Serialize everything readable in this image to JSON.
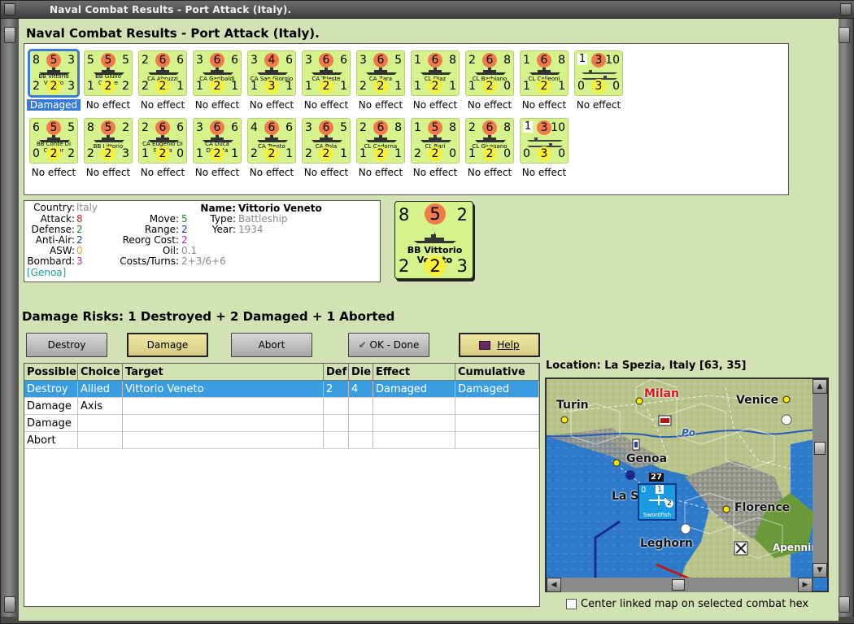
{
  "window": {
    "title": "Naval Combat Results - Port Attack (Italy)."
  },
  "dialog": {
    "title": "Naval Combat Results - Port Attack (Italy)."
  },
  "units_row1": [
    {
      "tl": "8",
      "c": "5",
      "tr": "3",
      "name": "BB Vittorio Veneto",
      "bl": "2",
      "y": "2",
      "br": "3",
      "result": "Damaged",
      "selected": true
    },
    {
      "tl": "5",
      "c": "5",
      "tr": "5",
      "name": "BB Giulio Cesare",
      "bl": "1",
      "y": "2",
      "br": "2",
      "result": "No effect"
    },
    {
      "tl": "2",
      "c": "6",
      "tr": "6",
      "name": "CA Abruzzi",
      "bl": "2",
      "y": "2",
      "br": "1",
      "result": "No effect"
    },
    {
      "tl": "3",
      "c": "6",
      "tr": "6",
      "name": "CA Garibaldi",
      "bl": "1",
      "y": "2",
      "br": "1",
      "result": "No effect"
    },
    {
      "tl": "3",
      "c": "4",
      "tr": "6",
      "name": "CA San Giorgio",
      "bl": "1",
      "y": "3",
      "br": "1",
      "result": "No effect"
    },
    {
      "tl": "3",
      "c": "6",
      "tr": "6",
      "name": "CA Trieste",
      "bl": "1",
      "y": "2",
      "br": "1",
      "result": "No effect"
    },
    {
      "tl": "3",
      "c": "6",
      "tr": "5",
      "name": "CA Zara",
      "bl": "2",
      "y": "2",
      "br": "1",
      "result": "No effect"
    },
    {
      "tl": "1",
      "c": "6",
      "tr": "8",
      "name": "CL Diaz",
      "bl": "1",
      "y": "2",
      "br": "1",
      "result": "No effect"
    },
    {
      "tl": "2",
      "c": "6",
      "tr": "8",
      "name": "CL Barbiano",
      "bl": "1",
      "y": "2",
      "br": "0",
      "result": "No effect"
    },
    {
      "tl": "1",
      "c": "6",
      "tr": "8",
      "name": "CL Colleoni",
      "bl": "1",
      "y": "2",
      "br": "1",
      "result": "No effect"
    },
    {
      "tl": "1",
      "c": "3",
      "tr": "10",
      "name": "",
      "bl": "0",
      "y": "3",
      "br": "0",
      "result": "No effect",
      "transport": true
    }
  ],
  "units_row2": [
    {
      "tl": "6",
      "c": "5",
      "tr": "5",
      "name": "BB Conte Di Cavour",
      "bl": "0",
      "y": "2",
      "br": "2",
      "result": "No effect"
    },
    {
      "tl": "8",
      "c": "5",
      "tr": "2",
      "name": "BB Littorio",
      "bl": "2",
      "y": "2",
      "br": "3",
      "result": "No effect"
    },
    {
      "tl": "2",
      "c": "6",
      "tr": "6",
      "name": "CA Eugenio Di Savoia",
      "bl": "1",
      "y": "2",
      "br": "0",
      "result": "No effect"
    },
    {
      "tl": "3",
      "c": "6",
      "tr": "6",
      "name": "CA Duca D'Aosta",
      "bl": "1",
      "y": "2",
      "br": "1",
      "result": "No effect"
    },
    {
      "tl": "4",
      "c": "6",
      "tr": "6",
      "name": "CA Trento",
      "bl": "2",
      "y": "2",
      "br": "1",
      "result": "No effect"
    },
    {
      "tl": "3",
      "c": "6",
      "tr": "5",
      "name": "CA Pola",
      "bl": "2",
      "y": "2",
      "br": "1",
      "result": "No effect"
    },
    {
      "tl": "2",
      "c": "6",
      "tr": "8",
      "name": "CL Cadorna",
      "bl": "1",
      "y": "2",
      "br": "1",
      "result": "No effect"
    },
    {
      "tl": "1",
      "c": "5",
      "tr": "8",
      "name": "CL Bari",
      "bl": "2",
      "y": "2",
      "br": "0",
      "result": "No effect"
    },
    {
      "tl": "2",
      "c": "6",
      "tr": "8",
      "name": "CL Giussano",
      "bl": "1",
      "y": "2",
      "br": "0",
      "result": "No effect"
    },
    {
      "tl": "1",
      "c": "3",
      "tr": "10",
      "name": "",
      "bl": "0",
      "y": "3",
      "br": "0",
      "result": "No effect",
      "transport": true
    }
  ],
  "info": {
    "country_label": "Country:",
    "country": "Italy",
    "attack_label": "Attack:",
    "attack": "8",
    "defense_label": "Defense:",
    "defense": "2",
    "antiair_label": "Anti-Air:",
    "antiair": "2",
    "asw_label": "ASW:",
    "asw": "0",
    "bombard_label": "Bombard:",
    "bombard": "3",
    "location": "[Genoa]",
    "move_label": "Move:",
    "move": "5",
    "range_label": "Range:",
    "range": "2",
    "reorg_label": "Reorg Cost:",
    "reorg": "2",
    "oil_label": "Oil:",
    "oil": "0.1",
    "costs_label": "Costs/Turns:",
    "costs": "2+3/6+6",
    "name_label": "Name:",
    "name": "Vittorio Veneto",
    "type_label": "Type:",
    "type": "Battleship",
    "year_label": "Year:",
    "year": "1934"
  },
  "big_counter": {
    "tl": "8",
    "c": "5",
    "tr": "2",
    "name1": "BB Vittorio",
    "name2": "Veneto",
    "bl": "2",
    "y": "2",
    "br": "3"
  },
  "damage_risks": "Damage Risks:  1 Destroyed + 2 Damaged + 1 Aborted",
  "buttons": {
    "destroy": "Destroy",
    "damage": "Damage",
    "abort": "Abort",
    "ok": "OK - Done",
    "help": "Help"
  },
  "table": {
    "headers": [
      "Possible",
      "Choice",
      "Target",
      "Def",
      "Die",
      "Effect",
      "Cumulative"
    ],
    "rows": [
      [
        "Destroy",
        "Allied",
        "Vittorio Veneto",
        "2",
        "4",
        "Damaged",
        "Damaged"
      ],
      [
        "Damage",
        "Axis",
        "",
        "",
        "",
        "",
        ""
      ],
      [
        "Damage",
        "",
        "",
        "",
        "",
        "",
        ""
      ],
      [
        "Abort",
        "",
        "",
        "",
        "",
        "",
        ""
      ]
    ]
  },
  "location": "Location:  La Spezia, Italy [63, 35]",
  "map": {
    "cities": {
      "turin": "Turin",
      "milan": "Milan",
      "venice": "Venice",
      "genoa": "Genoa",
      "laspezia": "La S",
      "florence": "Florence",
      "leghorn": "Leghorn",
      "apennin": "Apennin",
      "po": "Po"
    },
    "stack_count": "27",
    "unit_label": "Swordfish",
    "unit_tl": "0",
    "unit_tr": "1",
    "unit_br": "2"
  },
  "center_linked": "Center linked map on selected combat hex",
  "colors": {
    "panel_bg": "#d2e2b4",
    "counter_green": "#d6f28a",
    "attack_red": "#f07a4a",
    "defense_yellow": "#f6f03a",
    "selection_blue": "#3a9de0"
  }
}
